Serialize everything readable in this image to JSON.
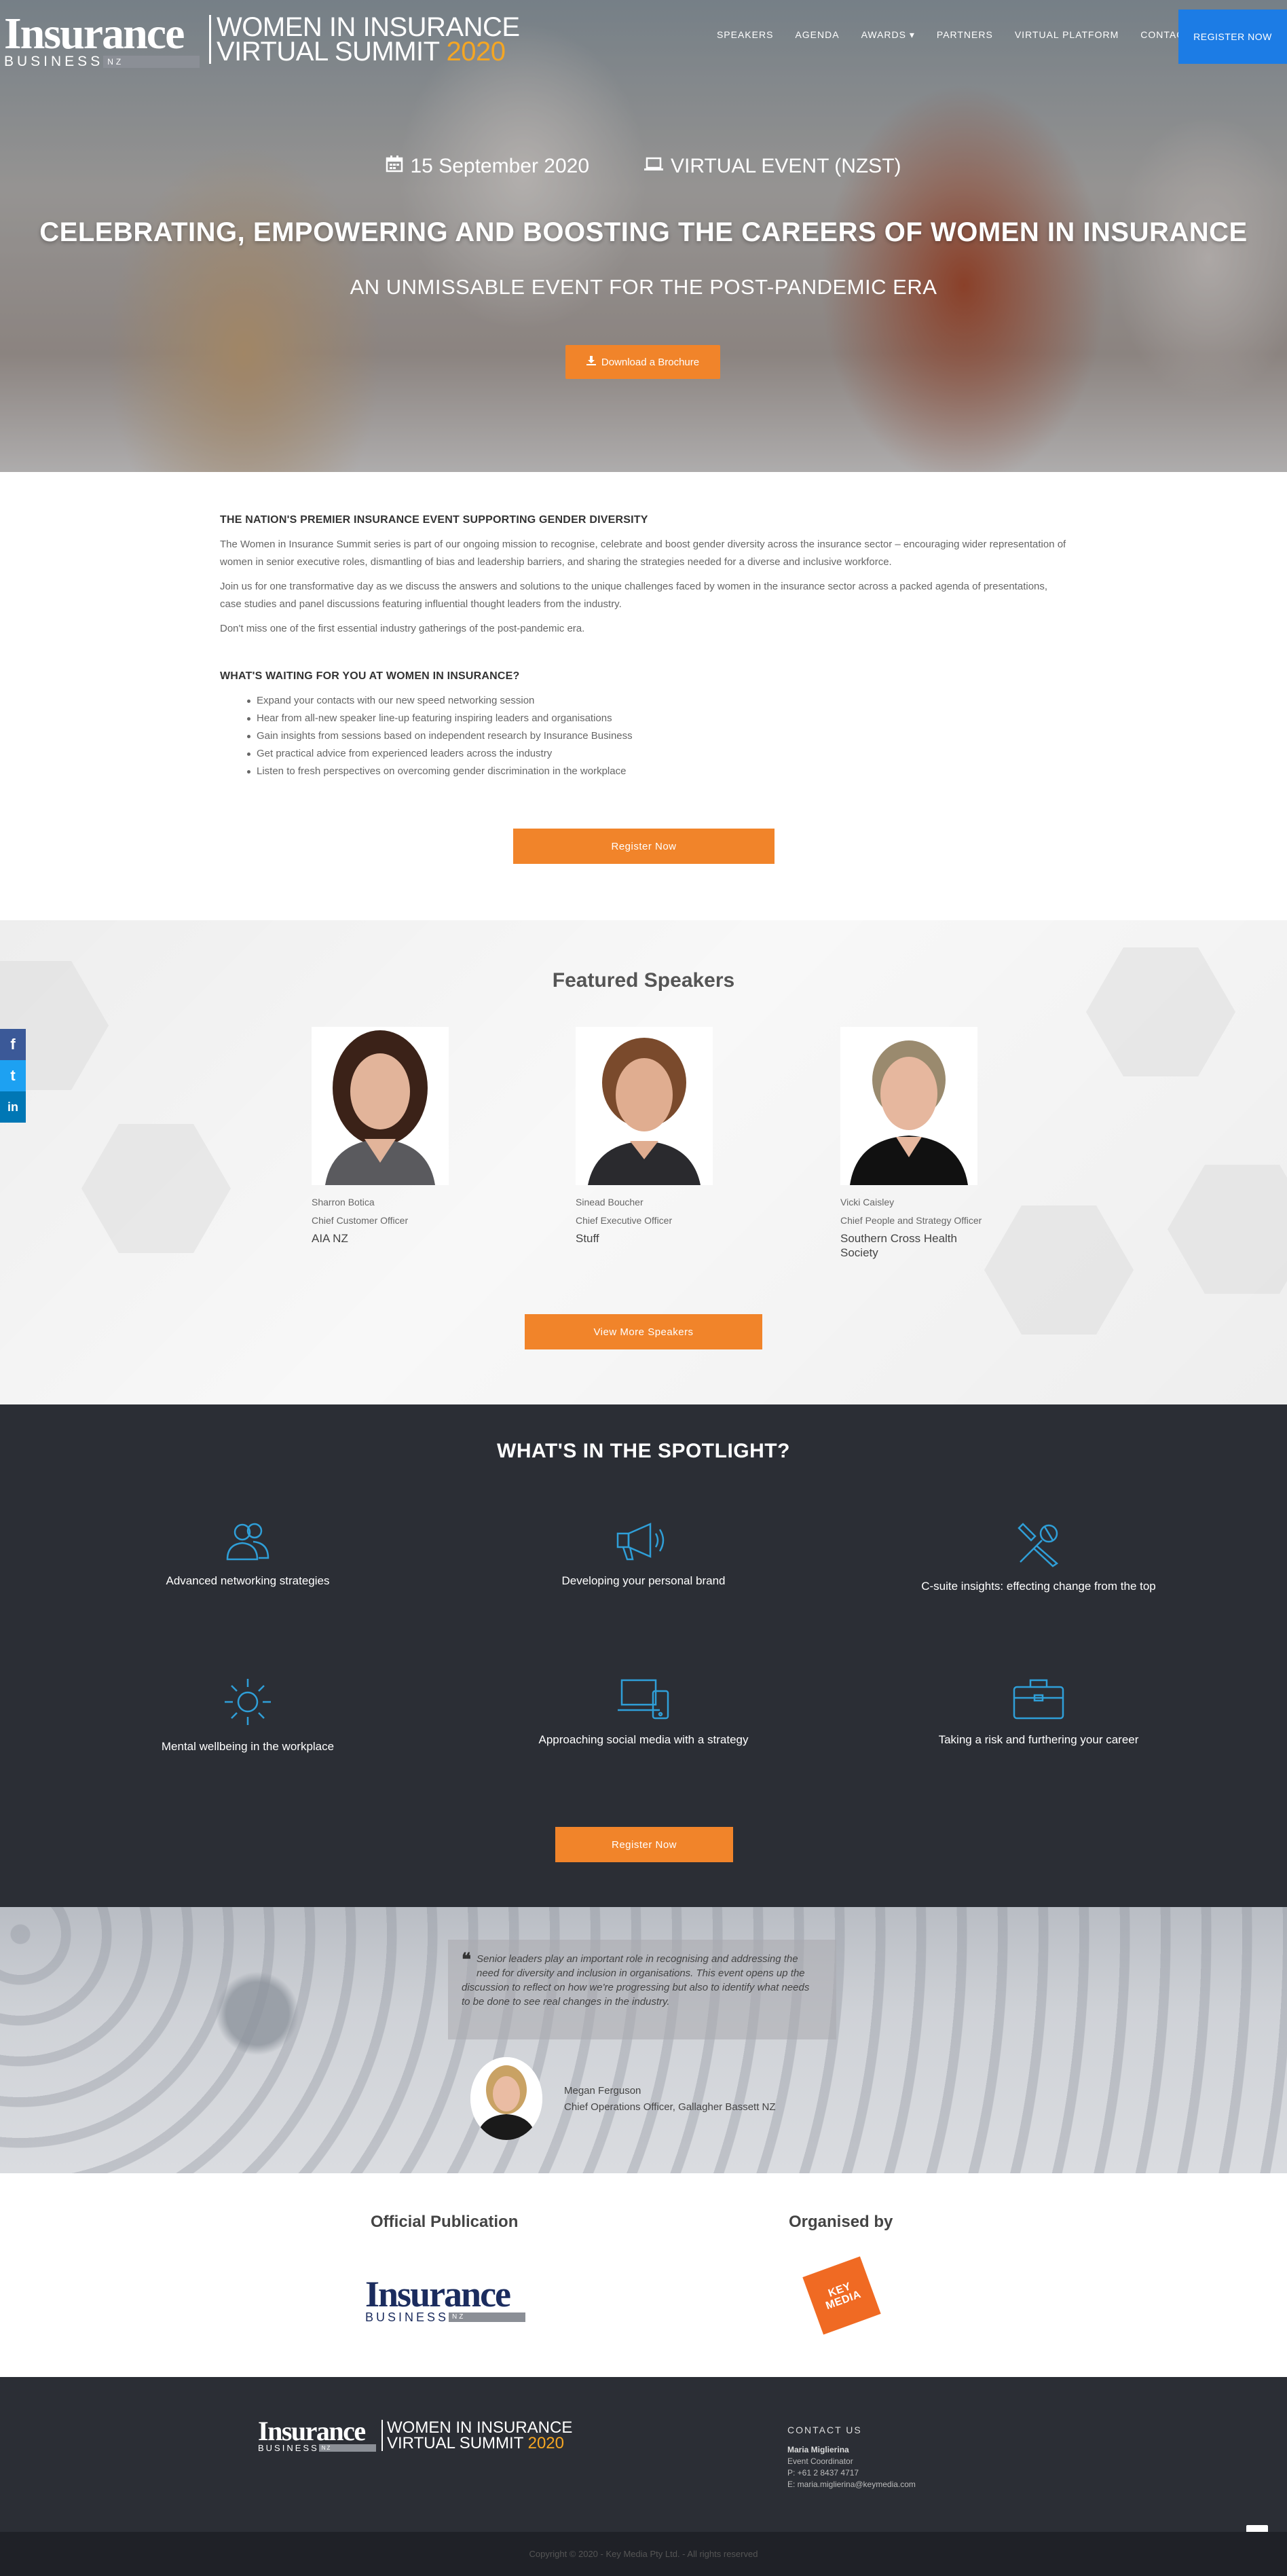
{
  "header": {
    "logo": {
      "word": "Insurance",
      "business": "BUSINESS",
      "nz": "NZ",
      "event_line1": "WOMEN IN INSURANCE",
      "event_line2": "VIRTUAL SUMMIT",
      "year": "2020"
    },
    "menu": [
      {
        "label": "SPEAKERS"
      },
      {
        "label": "AGENDA"
      },
      {
        "label": "AWARDS ▾"
      },
      {
        "label": "PARTNERS"
      },
      {
        "label": "VIRTUAL PLATFORM"
      },
      {
        "label": "CONTACT US"
      }
    ],
    "register_label": "REGISTER NOW"
  },
  "hero": {
    "date": "15 September 2020",
    "location": "VIRTUAL EVENT (NZST)",
    "title": "CELEBRATING, EMPOWERING AND BOOSTING THE CAREERS OF WOMEN IN INSURANCE",
    "subtitle": "AN UNMISSABLE EVENT FOR THE POST-PANDEMIC ERA",
    "brochure_label": "Download a Brochure"
  },
  "intro": {
    "heading": "THE NATION'S PREMIER INSURANCE EVENT SUPPORTING GENDER DIVERSITY",
    "p1": "The Women in Insurance Summit series is part of our ongoing mission to recognise, celebrate and boost gender diversity across the insurance sector – encouraging wider representation of women in senior executive roles, dismantling of bias and leadership barriers, and sharing the strategies needed for a diverse and inclusive workforce.",
    "p2": "Join us for one transformative day as we discuss the answers and solutions to the unique challenges faced by women in the insurance sector across a packed agenda of presentations, case studies and panel discussions featuring influential thought leaders from the industry.",
    "p3": "Don't miss one of the first essential industry gatherings of the post-pandemic era.",
    "waiting_heading": "WHAT'S WAITING FOR YOU AT WOMEN IN INSURANCE?",
    "bullets": [
      "Expand your contacts with our new speed networking session",
      "Hear from all-new speaker line-up featuring inspiring leaders and organisations",
      "Gain insights from sessions based on independent research by Insurance Business",
      "Get practical advice from experienced leaders across the industry",
      "Listen to fresh perspectives on overcoming gender discrimination in the workplace"
    ],
    "register_label": "Register Now"
  },
  "speakers": {
    "title": "Featured Speakers",
    "items": [
      {
        "name": "Sharron Botica",
        "role": "Chief Customer Officer",
        "company": "AIA NZ"
      },
      {
        "name": "Sinead Boucher",
        "role": "Chief Executive Officer",
        "company": "Stuff"
      },
      {
        "name": "Vicki Caisley",
        "role": "Chief People and Strategy Officer",
        "company": "Southern Cross Health Society"
      }
    ],
    "more_label": "View More Speakers"
  },
  "social": {
    "facebook": "f",
    "twitter": "t",
    "linkedin": "in"
  },
  "spotlight": {
    "title": "WHAT'S IN THE SPOTLIGHT?",
    "items": [
      {
        "label": "Advanced networking strategies",
        "icon": "people-icon"
      },
      {
        "label": "Developing your personal brand",
        "icon": "megaphone-icon"
      },
      {
        "label": "C-suite insights: effecting change from the top",
        "icon": "tools-icon"
      },
      {
        "label": "Mental wellbeing in the workplace",
        "icon": "sun-icon"
      },
      {
        "label": "Approaching social media with a strategy",
        "icon": "devices-icon"
      },
      {
        "label": "Taking a risk and furthering your career",
        "icon": "briefcase-icon"
      }
    ],
    "register_label": "Register Now",
    "icon_color": "#2f9fd8"
  },
  "testimonial": {
    "quote": "Senior leaders play an important role in recognising and addressing the need for diversity and inclusion in organisations. This event opens up the discussion to reflect on how we're progressing but also to identify what needs to be done to see real changes in the industry.",
    "name": "Megan Ferguson",
    "role": "Chief Operations Officer, Gallagher Bassett NZ"
  },
  "partners": {
    "publication_title": "Official Publication",
    "organiser_title": "Organised by",
    "km_line1": "KEY",
    "km_line2": "MEDIA"
  },
  "footer": {
    "contact_heading": "CONTACT US",
    "contact_name": "Maria Miglierina",
    "contact_role": "Event Coordinator",
    "contact_phone": "P: +61 2 8437 4717",
    "contact_email": "E: maria.miglierina@keymedia.com",
    "copyright": "Copyright © 2020 - Key Media Pty Ltd. - All rights reserved"
  },
  "colors": {
    "accent_orange": "#f1842a",
    "nav_blue": "#1c7ce5",
    "dark": "#2b2e35",
    "year_gold": "#f5a623"
  }
}
